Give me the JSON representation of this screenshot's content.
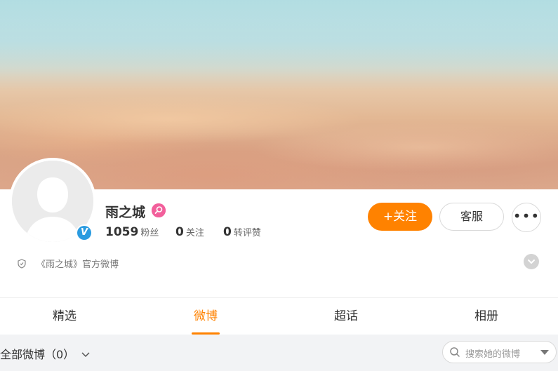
{
  "profile": {
    "name": "雨之城",
    "badge_icon": "pink-search-badge-icon",
    "verified_icon": "blue-v-verified-icon",
    "verified_label": "V",
    "stats": [
      {
        "count": "1059",
        "label": "粉丝"
      },
      {
        "count": "0",
        "label": "关注"
      },
      {
        "count": "0",
        "label": "转评赞"
      }
    ],
    "description": "《雨之城》官方微博"
  },
  "actions": {
    "follow_label": "+关注",
    "service_label": "客服",
    "more_label": "•••"
  },
  "tabs": [
    {
      "label": "精选",
      "active": false
    },
    {
      "label": "微博",
      "active": true
    },
    {
      "label": "超话",
      "active": false
    },
    {
      "label": "相册",
      "active": false
    }
  ],
  "filter": {
    "label": "全部微博（0）",
    "search_placeholder": "搜索她的微博"
  },
  "colors": {
    "accent": "#ff8200",
    "verified": "#2a9be0",
    "badge": "#f25f9b",
    "filter_bg": "#f2f3f5"
  }
}
